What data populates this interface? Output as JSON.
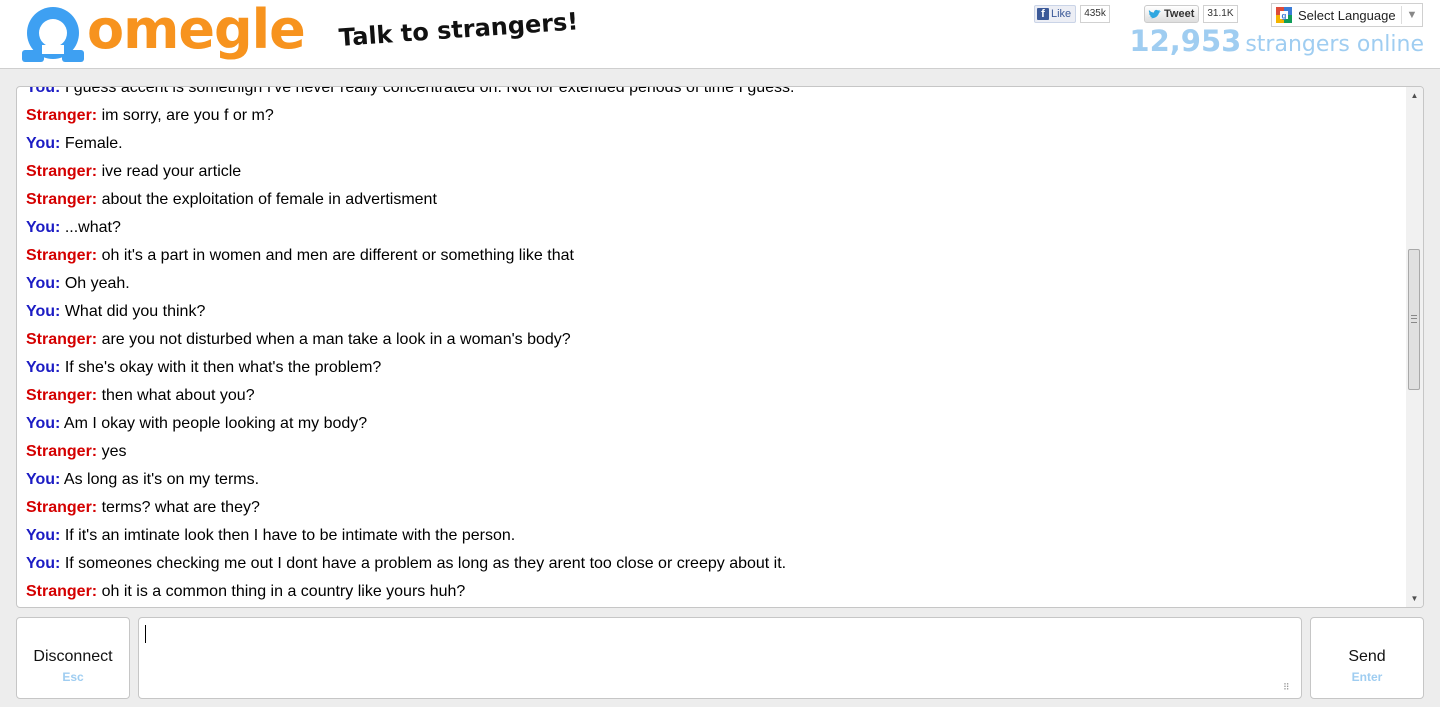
{
  "header": {
    "logo_text": "omegle",
    "tagline": "Talk to strangers!",
    "fb_like": {
      "label": "Like",
      "count": "435k"
    },
    "tweet": {
      "label": "Tweet",
      "count": "31.1K"
    },
    "language_select": {
      "label": "Select Language"
    },
    "online": {
      "count": "12,953",
      "label": "strangers online"
    }
  },
  "colors": {
    "logo_orange": "#f7931e",
    "logo_blue": "#3ea0f2",
    "you_blue": "#1c1cc4",
    "stranger_red": "#d40000",
    "accent_light_blue": "#9fcdf1"
  },
  "chat": {
    "messages": [
      {
        "speaker": "You:",
        "role": "you",
        "text": "I guess accent is somethign I've never really concentrated on. Not for extended periods of time I guess."
      },
      {
        "speaker": "Stranger:",
        "role": "stranger",
        "text": "im sorry, are you f or m?"
      },
      {
        "speaker": "You:",
        "role": "you",
        "text": "Female."
      },
      {
        "speaker": "Stranger:",
        "role": "stranger",
        "text": "ive read your article"
      },
      {
        "speaker": "Stranger:",
        "role": "stranger",
        "text": "about the exploitation of female in advertisment"
      },
      {
        "speaker": "You:",
        "role": "you",
        "text": "...what?"
      },
      {
        "speaker": "Stranger:",
        "role": "stranger",
        "text": "oh it's a part in women and men are different or something like that"
      },
      {
        "speaker": "You:",
        "role": "you",
        "text": "Oh yeah."
      },
      {
        "speaker": "You:",
        "role": "you",
        "text": "What did you think?"
      },
      {
        "speaker": "Stranger:",
        "role": "stranger",
        "text": "are you not disturbed when a man take a look in a woman's body?"
      },
      {
        "speaker": "You:",
        "role": "you",
        "text": "If she's okay with it then what's the problem?"
      },
      {
        "speaker": "Stranger:",
        "role": "stranger",
        "text": "then what about you?"
      },
      {
        "speaker": "You:",
        "role": "you",
        "text": "Am I okay with people looking at my body?"
      },
      {
        "speaker": "Stranger:",
        "role": "stranger",
        "text": "yes"
      },
      {
        "speaker": "You:",
        "role": "you",
        "text": "As long as it's on my terms."
      },
      {
        "speaker": "Stranger:",
        "role": "stranger",
        "text": "terms? what are they?"
      },
      {
        "speaker": "You:",
        "role": "you",
        "text": "If it's an imtinate look then I have to be intimate with the person."
      },
      {
        "speaker": "You:",
        "role": "you",
        "text": "If someones checking me out I dont have a problem as long as they arent too close or creepy about it."
      },
      {
        "speaker": "Stranger:",
        "role": "stranger",
        "text": "oh it is a common thing in a country like yours huh?"
      }
    ],
    "scroll_position": 0.42
  },
  "controls": {
    "disconnect": {
      "label": "Disconnect",
      "hint": "Esc"
    },
    "send": {
      "label": "Send",
      "hint": "Enter"
    },
    "input": {
      "value": ""
    }
  }
}
